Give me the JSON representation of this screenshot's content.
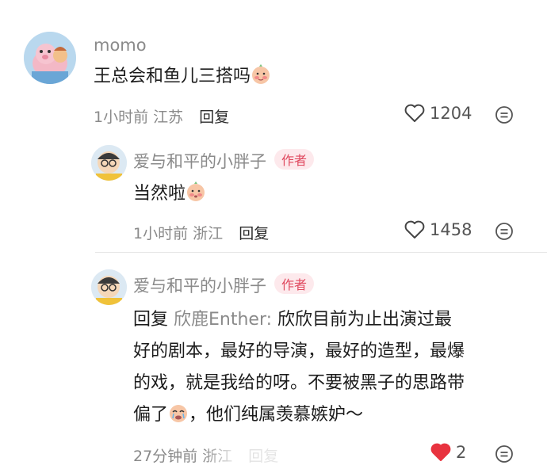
{
  "comments": [
    {
      "username": "momo",
      "text": "王总会和鱼儿三搭吗",
      "time": "1小时前",
      "location": "江苏",
      "reply_label": "回复",
      "likes": "1204",
      "liked": false
    },
    {
      "username": "爱与和平的小胖子",
      "badge": "作者",
      "text": "当然啦",
      "time": "1小时前",
      "location": "浙江",
      "reply_label": "回复",
      "likes": "1458",
      "liked": false
    },
    {
      "username": "爱与和平的小胖子",
      "badge": "作者",
      "reply_prefix": "回复",
      "reply_to": "欣鹿Enther:",
      "text_line1": "欣欣目前为止出演过最",
      "text_line2": "好的剧本，最好的导演，最好的造型，最爆",
      "text_line3": "的戏，就是我给的呀。不要被黑子的思路带",
      "text_line4a": "偏了",
      "text_line4b": "，他们纯属羡慕嫉妒～",
      "time": "27分钟前",
      "location": "浙江",
      "reply_label": "回复",
      "likes": "2",
      "liked": true
    }
  ],
  "colors": {
    "badge_text": "#e0495f",
    "badge_bg": "#fde9ec",
    "liked_heart": "#e8333f",
    "muted": "#8a8a8a"
  },
  "icons": {
    "like": "heart-icon",
    "more": "more-options-icon",
    "emoji": "blushing-face-emoji"
  }
}
